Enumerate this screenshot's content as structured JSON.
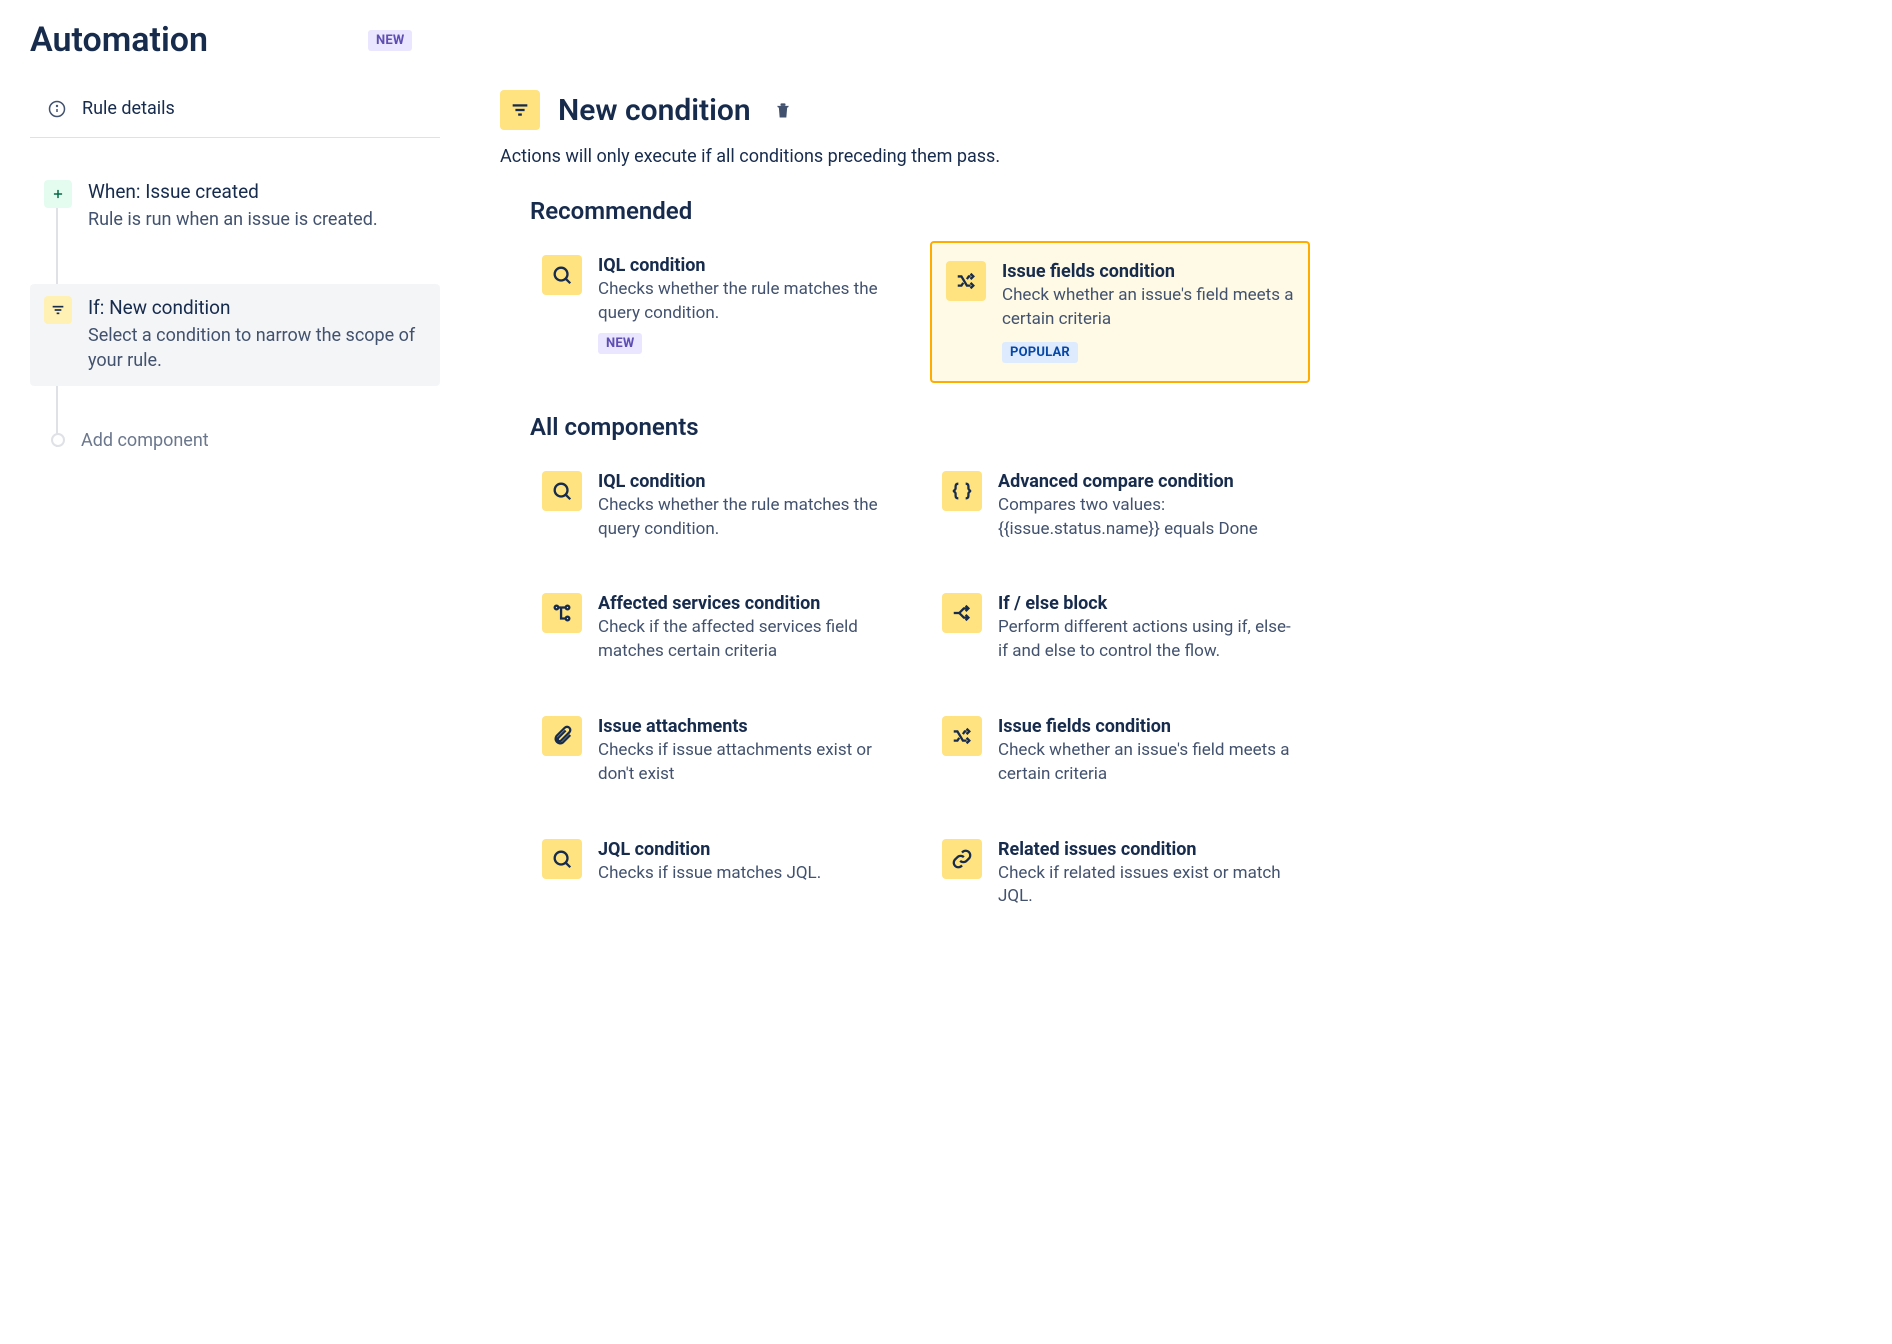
{
  "header": {
    "title": "Automation",
    "badge": "NEW"
  },
  "sidebar": {
    "rule_details": "Rule details",
    "trigger": {
      "title": "When: Issue created",
      "desc": "Rule is run when an issue is created."
    },
    "condition": {
      "title": "If: New condition",
      "desc": "Select a condition to narrow the scope of your rule."
    },
    "add_component": "Add component"
  },
  "main": {
    "title": "New condition",
    "subtitle": "Actions will only execute if all conditions preceding them pass.",
    "recommended_label": "Recommended",
    "all_label": "All components",
    "recommended": [
      {
        "title": "IQL condition",
        "desc": "Checks whether the rule matches the query condition.",
        "badge": "NEW",
        "icon": "search"
      },
      {
        "title": "Issue fields condition",
        "desc": "Check whether an issue's field meets a certain criteria",
        "badge": "POPULAR",
        "icon": "shuffle",
        "highlighted": true
      }
    ],
    "all": [
      {
        "title": "IQL condition",
        "desc": "Checks whether the rule matches the query condition.",
        "icon": "search"
      },
      {
        "title": "Advanced compare condition",
        "desc": "Compares two values: {{issue.status.name}} equals Done",
        "icon": "braces"
      },
      {
        "title": "Affected services condition",
        "desc": "Check if the affected services field matches certain criteria",
        "icon": "nodes"
      },
      {
        "title": "If / else block",
        "desc": "Perform different actions using if, else-if and else to control the flow.",
        "icon": "branch"
      },
      {
        "title": "Issue attachments",
        "desc": "Checks if issue attachments exist or don't exist",
        "icon": "attachment"
      },
      {
        "title": "Issue fields condition",
        "desc": "Check whether an issue's field meets a certain criteria",
        "icon": "shuffle"
      },
      {
        "title": "JQL condition",
        "desc": "Checks if issue matches JQL.",
        "icon": "search"
      },
      {
        "title": "Related issues condition",
        "desc": "Check if related issues exist or match JQL.",
        "icon": "link"
      }
    ]
  }
}
